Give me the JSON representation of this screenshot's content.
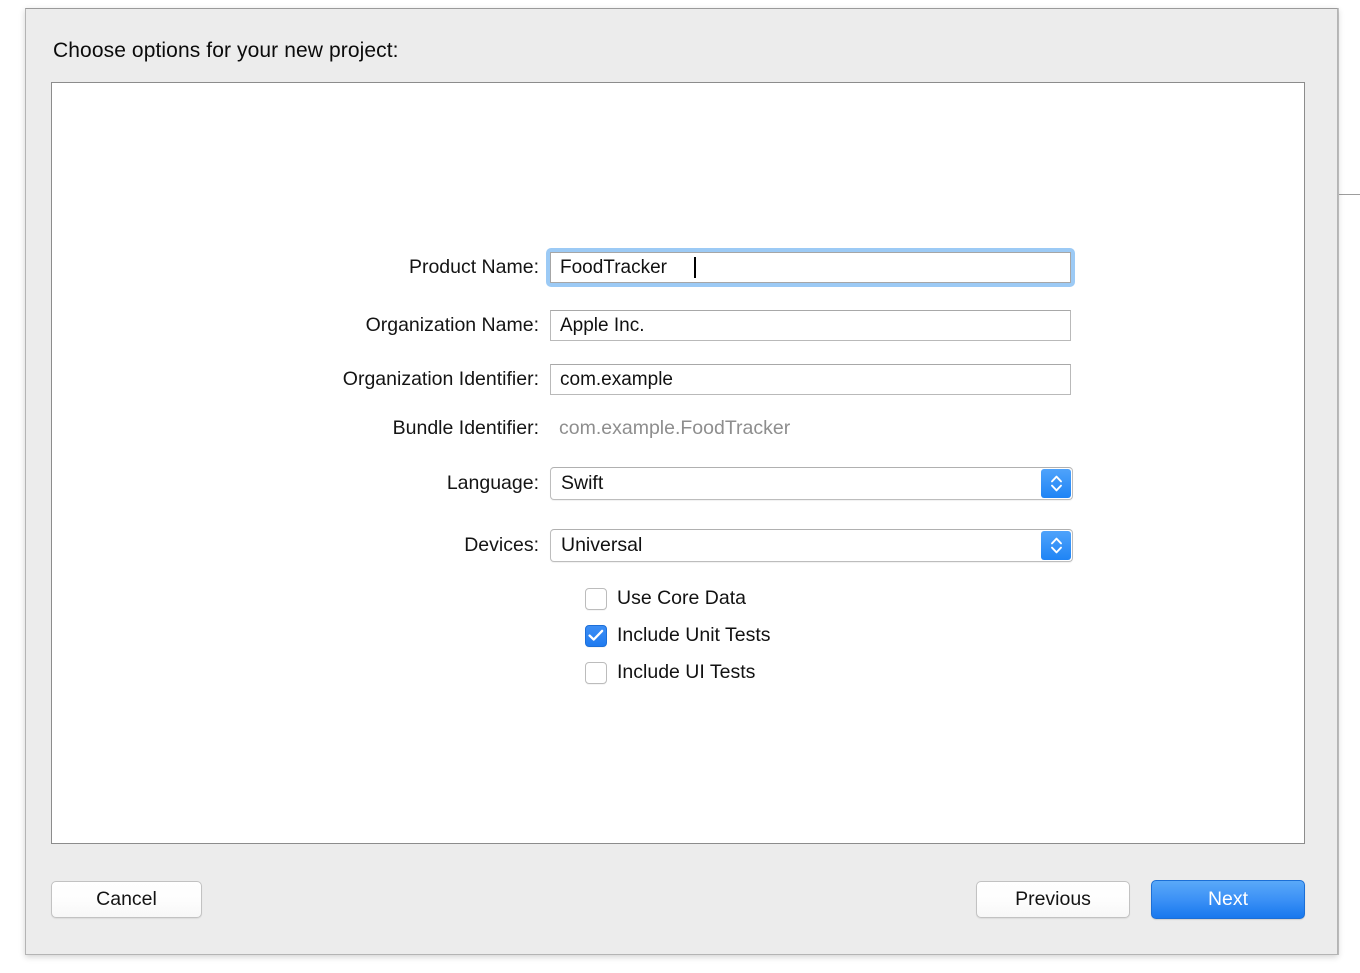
{
  "dialog": {
    "header": "Choose options for your new project:"
  },
  "form": {
    "fields": [
      {
        "label": "Product Name:",
        "value": "FoodTracker",
        "placeholder": "",
        "type": "text",
        "focused": true
      },
      {
        "label": "Organization Name:",
        "value": "Apple Inc.",
        "placeholder": "",
        "type": "text",
        "focused": false
      },
      {
        "label": "Organization Identifier:",
        "value": "com.example",
        "placeholder": "",
        "type": "text",
        "focused": false
      },
      {
        "label": "Bundle Identifier:",
        "value": "com.example.FoodTracker",
        "type": "static"
      },
      {
        "label": "Language:",
        "value": "Swift",
        "type": "popup"
      },
      {
        "label": "Devices:",
        "value": "Universal",
        "type": "popup"
      }
    ],
    "checkboxes": [
      {
        "label": "Use Core Data",
        "checked": false
      },
      {
        "label": "Include Unit Tests",
        "checked": true
      },
      {
        "label": "Include UI Tests",
        "checked": false
      }
    ]
  },
  "footer": {
    "cancel_label": "Cancel",
    "previous_label": "Previous",
    "next_label": "Next"
  },
  "colors": {
    "accent_blue": "#1f84f5",
    "default_button_blue": "#3d92f6",
    "focus_ring": "#9ccaf5",
    "window_background": "#ececec",
    "panel_background": "#ffffff",
    "static_text_grey": "#8e8e8e"
  }
}
